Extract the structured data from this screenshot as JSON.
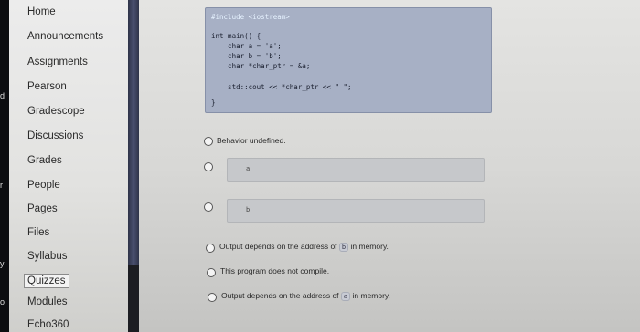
{
  "left_edge": [
    "d",
    "r",
    "y",
    "o"
  ],
  "sidebar": {
    "items": [
      {
        "label": "Home"
      },
      {
        "label": "Announcements"
      },
      {
        "label": "Assignments"
      },
      {
        "label": "Pearson"
      },
      {
        "label": "Gradescope"
      },
      {
        "label": "Discussions"
      },
      {
        "label": "Grades"
      },
      {
        "label": "People"
      },
      {
        "label": "Pages"
      },
      {
        "label": "Files"
      },
      {
        "label": "Syllabus"
      },
      {
        "label": "Quizzes",
        "active": true
      },
      {
        "label": "Modules"
      },
      {
        "label": "Echo360"
      }
    ]
  },
  "question": {
    "code_lines": [
      "#include <iostream>",
      "int main() {",
      "    char a = 'a';",
      "    char b = 'b';",
      "    char *char_ptr = &a;",
      "    std::cout << *char_ptr << \" \";",
      "}"
    ]
  },
  "options": {
    "behavior_undefined": "Behavior undefined.",
    "code_a": "a",
    "code_b": "b",
    "addr_b_prefix": "Output depends on the address of",
    "addr_b_code": "b",
    "addr_b_suffix": "in memory.",
    "no_compile": "This program does not compile.",
    "addr_a_prefix": "Output depends on the address of",
    "addr_a_code": "a",
    "addr_a_suffix": "in memory."
  }
}
